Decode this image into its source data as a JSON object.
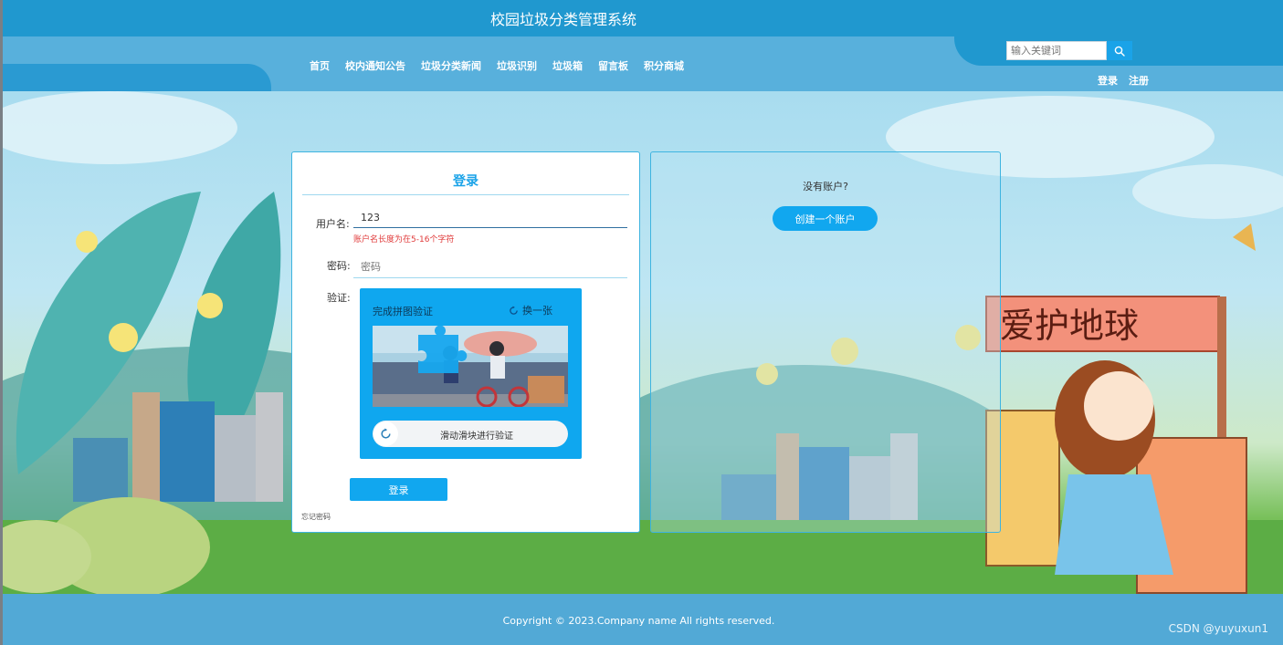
{
  "header": {
    "site_title": "校园垃圾分类管理系统",
    "search": {
      "placeholder": "输入关键词",
      "value": ""
    },
    "search_icon": "search-icon",
    "login_link": "登录",
    "register_link": "注册",
    "accent_color": "#2098cf"
  },
  "nav": {
    "items": [
      {
        "label": "首页"
      },
      {
        "label": "校内通知公告"
      },
      {
        "label": "垃圾分类新闻"
      },
      {
        "label": "垃圾识别"
      },
      {
        "label": "垃圾箱"
      },
      {
        "label": "留言板"
      },
      {
        "label": "积分商城"
      }
    ]
  },
  "login": {
    "title": "登录",
    "username_label": "用户名:",
    "username_value": "123",
    "username_error": "账户名长度为在5-16个字符",
    "password_label": "密码:",
    "password_placeholder": "密码",
    "captcha_label": "验证:",
    "captcha": {
      "title": "完成拼图验证",
      "refresh": "换一张",
      "slider_text": "滑动滑块进行验证"
    },
    "submit": "登录",
    "forgot": "忘记密码",
    "error_color": "#e03a3a"
  },
  "register": {
    "question": "没有账户?",
    "button": "创建一个账户"
  },
  "banner": {
    "sign_text": "爱护地球"
  },
  "footer": {
    "copyright": "Copyright © 2023.Company name All rights reserved.",
    "watermark": "CSDN @yuyuxun1"
  }
}
